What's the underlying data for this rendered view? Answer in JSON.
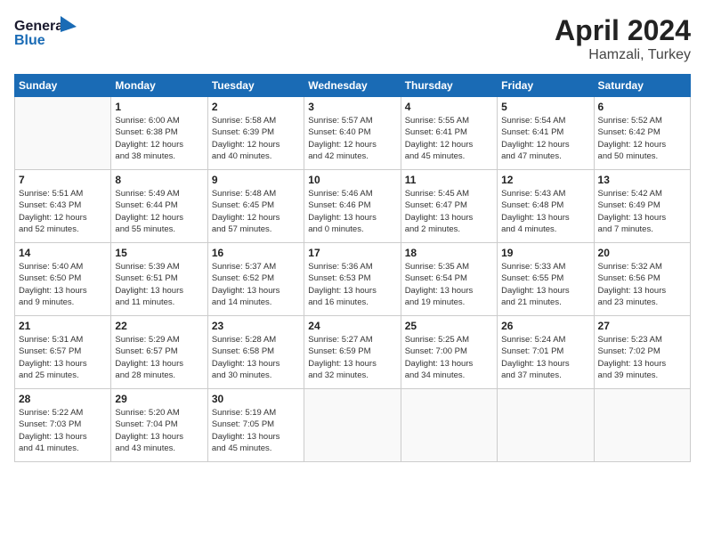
{
  "header": {
    "logo_line1": "General",
    "logo_line2": "Blue",
    "month": "April 2024",
    "location": "Hamzali, Turkey"
  },
  "weekdays": [
    "Sunday",
    "Monday",
    "Tuesday",
    "Wednesday",
    "Thursday",
    "Friday",
    "Saturday"
  ],
  "weeks": [
    [
      {
        "day": "",
        "info": ""
      },
      {
        "day": "1",
        "info": "Sunrise: 6:00 AM\nSunset: 6:38 PM\nDaylight: 12 hours\nand 38 minutes."
      },
      {
        "day": "2",
        "info": "Sunrise: 5:58 AM\nSunset: 6:39 PM\nDaylight: 12 hours\nand 40 minutes."
      },
      {
        "day": "3",
        "info": "Sunrise: 5:57 AM\nSunset: 6:40 PM\nDaylight: 12 hours\nand 42 minutes."
      },
      {
        "day": "4",
        "info": "Sunrise: 5:55 AM\nSunset: 6:41 PM\nDaylight: 12 hours\nand 45 minutes."
      },
      {
        "day": "5",
        "info": "Sunrise: 5:54 AM\nSunset: 6:41 PM\nDaylight: 12 hours\nand 47 minutes."
      },
      {
        "day": "6",
        "info": "Sunrise: 5:52 AM\nSunset: 6:42 PM\nDaylight: 12 hours\nand 50 minutes."
      }
    ],
    [
      {
        "day": "7",
        "info": "Sunrise: 5:51 AM\nSunset: 6:43 PM\nDaylight: 12 hours\nand 52 minutes."
      },
      {
        "day": "8",
        "info": "Sunrise: 5:49 AM\nSunset: 6:44 PM\nDaylight: 12 hours\nand 55 minutes."
      },
      {
        "day": "9",
        "info": "Sunrise: 5:48 AM\nSunset: 6:45 PM\nDaylight: 12 hours\nand 57 minutes."
      },
      {
        "day": "10",
        "info": "Sunrise: 5:46 AM\nSunset: 6:46 PM\nDaylight: 13 hours\nand 0 minutes."
      },
      {
        "day": "11",
        "info": "Sunrise: 5:45 AM\nSunset: 6:47 PM\nDaylight: 13 hours\nand 2 minutes."
      },
      {
        "day": "12",
        "info": "Sunrise: 5:43 AM\nSunset: 6:48 PM\nDaylight: 13 hours\nand 4 minutes."
      },
      {
        "day": "13",
        "info": "Sunrise: 5:42 AM\nSunset: 6:49 PM\nDaylight: 13 hours\nand 7 minutes."
      }
    ],
    [
      {
        "day": "14",
        "info": "Sunrise: 5:40 AM\nSunset: 6:50 PM\nDaylight: 13 hours\nand 9 minutes."
      },
      {
        "day": "15",
        "info": "Sunrise: 5:39 AM\nSunset: 6:51 PM\nDaylight: 13 hours\nand 11 minutes."
      },
      {
        "day": "16",
        "info": "Sunrise: 5:37 AM\nSunset: 6:52 PM\nDaylight: 13 hours\nand 14 minutes."
      },
      {
        "day": "17",
        "info": "Sunrise: 5:36 AM\nSunset: 6:53 PM\nDaylight: 13 hours\nand 16 minutes."
      },
      {
        "day": "18",
        "info": "Sunrise: 5:35 AM\nSunset: 6:54 PM\nDaylight: 13 hours\nand 19 minutes."
      },
      {
        "day": "19",
        "info": "Sunrise: 5:33 AM\nSunset: 6:55 PM\nDaylight: 13 hours\nand 21 minutes."
      },
      {
        "day": "20",
        "info": "Sunrise: 5:32 AM\nSunset: 6:56 PM\nDaylight: 13 hours\nand 23 minutes."
      }
    ],
    [
      {
        "day": "21",
        "info": "Sunrise: 5:31 AM\nSunset: 6:57 PM\nDaylight: 13 hours\nand 25 minutes."
      },
      {
        "day": "22",
        "info": "Sunrise: 5:29 AM\nSunset: 6:57 PM\nDaylight: 13 hours\nand 28 minutes."
      },
      {
        "day": "23",
        "info": "Sunrise: 5:28 AM\nSunset: 6:58 PM\nDaylight: 13 hours\nand 30 minutes."
      },
      {
        "day": "24",
        "info": "Sunrise: 5:27 AM\nSunset: 6:59 PM\nDaylight: 13 hours\nand 32 minutes."
      },
      {
        "day": "25",
        "info": "Sunrise: 5:25 AM\nSunset: 7:00 PM\nDaylight: 13 hours\nand 34 minutes."
      },
      {
        "day": "26",
        "info": "Sunrise: 5:24 AM\nSunset: 7:01 PM\nDaylight: 13 hours\nand 37 minutes."
      },
      {
        "day": "27",
        "info": "Sunrise: 5:23 AM\nSunset: 7:02 PM\nDaylight: 13 hours\nand 39 minutes."
      }
    ],
    [
      {
        "day": "28",
        "info": "Sunrise: 5:22 AM\nSunset: 7:03 PM\nDaylight: 13 hours\nand 41 minutes."
      },
      {
        "day": "29",
        "info": "Sunrise: 5:20 AM\nSunset: 7:04 PM\nDaylight: 13 hours\nand 43 minutes."
      },
      {
        "day": "30",
        "info": "Sunrise: 5:19 AM\nSunset: 7:05 PM\nDaylight: 13 hours\nand 45 minutes."
      },
      {
        "day": "",
        "info": ""
      },
      {
        "day": "",
        "info": ""
      },
      {
        "day": "",
        "info": ""
      },
      {
        "day": "",
        "info": ""
      }
    ]
  ]
}
